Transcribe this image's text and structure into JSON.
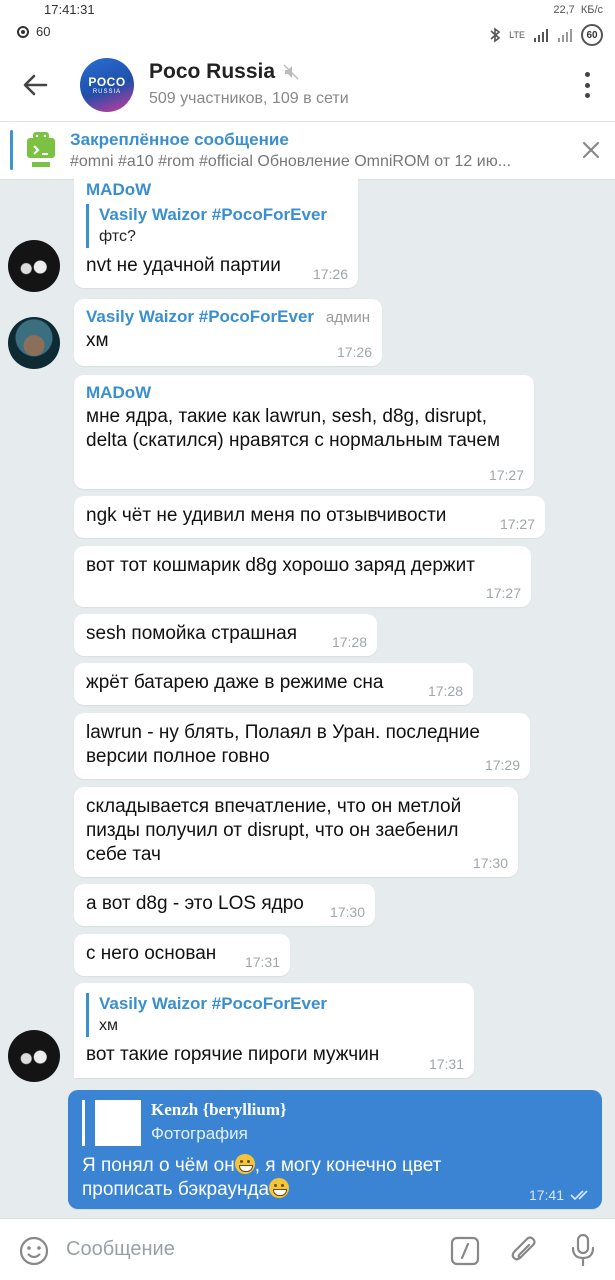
{
  "statusbar": {
    "time": "17:41:31",
    "notif_count": "60",
    "net_speed": "22,7",
    "net_unit": "КБ/с",
    "battery": "60",
    "network": "LTE"
  },
  "header": {
    "title": "Poco Russia",
    "subtitle": "509 участников, 109 в сети",
    "avatar_top": "POCO",
    "avatar_bottom": "RUSSIA"
  },
  "pinned": {
    "title": "Закреплённое сообщение",
    "text": "#omni #a10 #rom #official  Обновление OmniROM от 12 ию..."
  },
  "messages": [
    {
      "sender": "MADoW",
      "reply_name": "Vasily Waizor #PocoForEver",
      "reply_text": "фтс?",
      "text": "nvt не удачной партии",
      "time": "17:26"
    },
    {
      "sender": "Vasily Waizor #PocoForEver",
      "role": "админ",
      "text": "хм",
      "time": "17:26"
    },
    {
      "sender": "MADoW",
      "text": "мне ядра, такие как lawrun, sesh, d8g, disrupt, delta (скатился) нравятся с нормальным тачем",
      "time": "17:27"
    },
    {
      "text": "ngk чёт не удивил меня по отзывчивости",
      "time": "17:27"
    },
    {
      "text": "вот тот кошмарик d8g хорошо заряд держит",
      "time": "17:27"
    },
    {
      "text": "sesh помойка страшная",
      "time": "17:28"
    },
    {
      "text": "жрёт батарею даже в режиме сна",
      "time": "17:28"
    },
    {
      "text": "lawrun - ну блять, Полаял в Уран. последние версии полное говно",
      "time": "17:29"
    },
    {
      "text": "складывается впечатление, что он метлой пизды получил от disrupt, что он заебенил себе тач",
      "time": "17:30"
    },
    {
      "text": "а вот d8g - это LOS ядро",
      "time": "17:30"
    },
    {
      "text": "с него основан",
      "time": "17:31"
    },
    {
      "reply_name": "Vasily Waizor #PocoForEver",
      "reply_text": "хм",
      "text": "вот такие горячие пироги мужчин",
      "time": "17:31"
    }
  ],
  "outgoing": {
    "fwd_name": "Kenzh {beryllium}",
    "fwd_type": "Фотография",
    "text_part1": "Я понял о чём он",
    "text_part2": ", я могу конечно цвет прописать бэкраунда",
    "time": "17:41"
  },
  "input": {
    "placeholder": "Сообщение"
  },
  "colors": {
    "accent": "#3a8fd0",
    "outgoing_bubble": "#3a84d3",
    "chat_bg": "#e6ebee"
  }
}
